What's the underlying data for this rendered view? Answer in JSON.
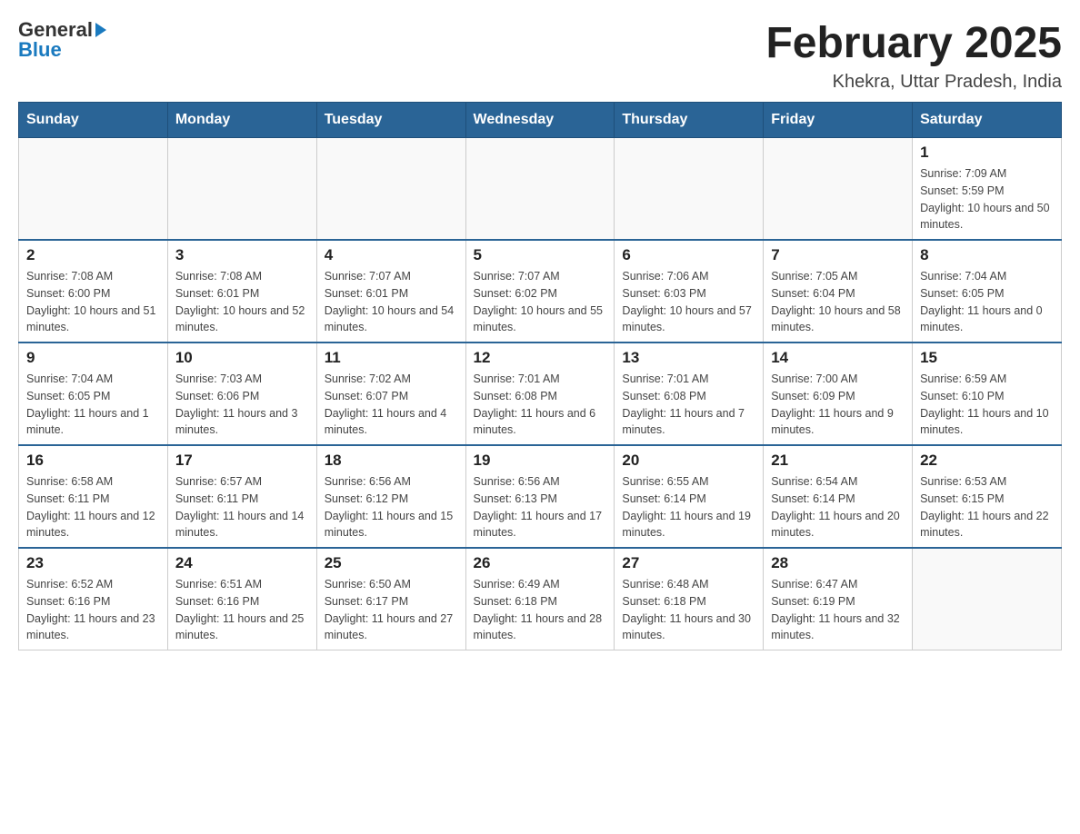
{
  "header": {
    "logo_general": "General",
    "logo_blue": "Blue",
    "title": "February 2025",
    "location": "Khekra, Uttar Pradesh, India"
  },
  "days_of_week": [
    "Sunday",
    "Monday",
    "Tuesday",
    "Wednesday",
    "Thursday",
    "Friday",
    "Saturday"
  ],
  "weeks": [
    [
      {
        "day": "",
        "sunrise": "",
        "sunset": "",
        "daylight": ""
      },
      {
        "day": "",
        "sunrise": "",
        "sunset": "",
        "daylight": ""
      },
      {
        "day": "",
        "sunrise": "",
        "sunset": "",
        "daylight": ""
      },
      {
        "day": "",
        "sunrise": "",
        "sunset": "",
        "daylight": ""
      },
      {
        "day": "",
        "sunrise": "",
        "sunset": "",
        "daylight": ""
      },
      {
        "day": "",
        "sunrise": "",
        "sunset": "",
        "daylight": ""
      },
      {
        "day": "1",
        "sunrise": "Sunrise: 7:09 AM",
        "sunset": "Sunset: 5:59 PM",
        "daylight": "Daylight: 10 hours and 50 minutes."
      }
    ],
    [
      {
        "day": "2",
        "sunrise": "Sunrise: 7:08 AM",
        "sunset": "Sunset: 6:00 PM",
        "daylight": "Daylight: 10 hours and 51 minutes."
      },
      {
        "day": "3",
        "sunrise": "Sunrise: 7:08 AM",
        "sunset": "Sunset: 6:01 PM",
        "daylight": "Daylight: 10 hours and 52 minutes."
      },
      {
        "day": "4",
        "sunrise": "Sunrise: 7:07 AM",
        "sunset": "Sunset: 6:01 PM",
        "daylight": "Daylight: 10 hours and 54 minutes."
      },
      {
        "day": "5",
        "sunrise": "Sunrise: 7:07 AM",
        "sunset": "Sunset: 6:02 PM",
        "daylight": "Daylight: 10 hours and 55 minutes."
      },
      {
        "day": "6",
        "sunrise": "Sunrise: 7:06 AM",
        "sunset": "Sunset: 6:03 PM",
        "daylight": "Daylight: 10 hours and 57 minutes."
      },
      {
        "day": "7",
        "sunrise": "Sunrise: 7:05 AM",
        "sunset": "Sunset: 6:04 PM",
        "daylight": "Daylight: 10 hours and 58 minutes."
      },
      {
        "day": "8",
        "sunrise": "Sunrise: 7:04 AM",
        "sunset": "Sunset: 6:05 PM",
        "daylight": "Daylight: 11 hours and 0 minutes."
      }
    ],
    [
      {
        "day": "9",
        "sunrise": "Sunrise: 7:04 AM",
        "sunset": "Sunset: 6:05 PM",
        "daylight": "Daylight: 11 hours and 1 minute."
      },
      {
        "day": "10",
        "sunrise": "Sunrise: 7:03 AM",
        "sunset": "Sunset: 6:06 PM",
        "daylight": "Daylight: 11 hours and 3 minutes."
      },
      {
        "day": "11",
        "sunrise": "Sunrise: 7:02 AM",
        "sunset": "Sunset: 6:07 PM",
        "daylight": "Daylight: 11 hours and 4 minutes."
      },
      {
        "day": "12",
        "sunrise": "Sunrise: 7:01 AM",
        "sunset": "Sunset: 6:08 PM",
        "daylight": "Daylight: 11 hours and 6 minutes."
      },
      {
        "day": "13",
        "sunrise": "Sunrise: 7:01 AM",
        "sunset": "Sunset: 6:08 PM",
        "daylight": "Daylight: 11 hours and 7 minutes."
      },
      {
        "day": "14",
        "sunrise": "Sunrise: 7:00 AM",
        "sunset": "Sunset: 6:09 PM",
        "daylight": "Daylight: 11 hours and 9 minutes."
      },
      {
        "day": "15",
        "sunrise": "Sunrise: 6:59 AM",
        "sunset": "Sunset: 6:10 PM",
        "daylight": "Daylight: 11 hours and 10 minutes."
      }
    ],
    [
      {
        "day": "16",
        "sunrise": "Sunrise: 6:58 AM",
        "sunset": "Sunset: 6:11 PM",
        "daylight": "Daylight: 11 hours and 12 minutes."
      },
      {
        "day": "17",
        "sunrise": "Sunrise: 6:57 AM",
        "sunset": "Sunset: 6:11 PM",
        "daylight": "Daylight: 11 hours and 14 minutes."
      },
      {
        "day": "18",
        "sunrise": "Sunrise: 6:56 AM",
        "sunset": "Sunset: 6:12 PM",
        "daylight": "Daylight: 11 hours and 15 minutes."
      },
      {
        "day": "19",
        "sunrise": "Sunrise: 6:56 AM",
        "sunset": "Sunset: 6:13 PM",
        "daylight": "Daylight: 11 hours and 17 minutes."
      },
      {
        "day": "20",
        "sunrise": "Sunrise: 6:55 AM",
        "sunset": "Sunset: 6:14 PM",
        "daylight": "Daylight: 11 hours and 19 minutes."
      },
      {
        "day": "21",
        "sunrise": "Sunrise: 6:54 AM",
        "sunset": "Sunset: 6:14 PM",
        "daylight": "Daylight: 11 hours and 20 minutes."
      },
      {
        "day": "22",
        "sunrise": "Sunrise: 6:53 AM",
        "sunset": "Sunset: 6:15 PM",
        "daylight": "Daylight: 11 hours and 22 minutes."
      }
    ],
    [
      {
        "day": "23",
        "sunrise": "Sunrise: 6:52 AM",
        "sunset": "Sunset: 6:16 PM",
        "daylight": "Daylight: 11 hours and 23 minutes."
      },
      {
        "day": "24",
        "sunrise": "Sunrise: 6:51 AM",
        "sunset": "Sunset: 6:16 PM",
        "daylight": "Daylight: 11 hours and 25 minutes."
      },
      {
        "day": "25",
        "sunrise": "Sunrise: 6:50 AM",
        "sunset": "Sunset: 6:17 PM",
        "daylight": "Daylight: 11 hours and 27 minutes."
      },
      {
        "day": "26",
        "sunrise": "Sunrise: 6:49 AM",
        "sunset": "Sunset: 6:18 PM",
        "daylight": "Daylight: 11 hours and 28 minutes."
      },
      {
        "day": "27",
        "sunrise": "Sunrise: 6:48 AM",
        "sunset": "Sunset: 6:18 PM",
        "daylight": "Daylight: 11 hours and 30 minutes."
      },
      {
        "day": "28",
        "sunrise": "Sunrise: 6:47 AM",
        "sunset": "Sunset: 6:19 PM",
        "daylight": "Daylight: 11 hours and 32 minutes."
      },
      {
        "day": "",
        "sunrise": "",
        "sunset": "",
        "daylight": ""
      }
    ]
  ]
}
